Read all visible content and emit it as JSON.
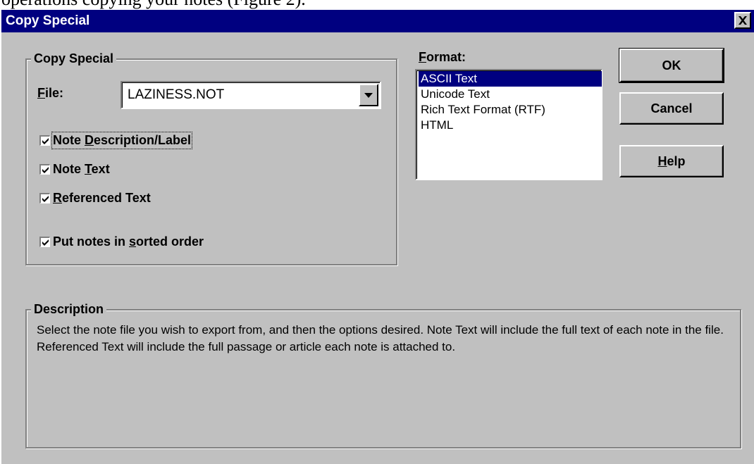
{
  "page_top_text": "operations copying your notes (Figure 2).",
  "dialog": {
    "title": "Copy Special",
    "close_glyph": "✕"
  },
  "copy_group": {
    "legend": "Copy Special",
    "file_label_u": "F",
    "file_label_rest": "ile:",
    "file_value": "LAZINESS.NOT",
    "options": [
      {
        "pre": "Note ",
        "u": "D",
        "post": "escription/Label",
        "checked": true
      },
      {
        "pre": "Note ",
        "u": "T",
        "post": "ext",
        "checked": true
      },
      {
        "pre": "",
        "u": "R",
        "post": "eferenced Text",
        "checked": true
      },
      {
        "pre": "Put notes in ",
        "u": "s",
        "post": "orted order",
        "checked": true
      }
    ]
  },
  "format": {
    "label_u": "F",
    "label_rest": "ormat:",
    "items": [
      "ASCII Text",
      "Unicode Text",
      "Rich Text Format (RTF)",
      "HTML"
    ],
    "selected": "ASCII Text"
  },
  "buttons": {
    "ok": "OK",
    "cancel": "Cancel",
    "help_u": "H",
    "help_rest": "elp"
  },
  "description": {
    "legend": "Description",
    "text": "Select the note file you wish to export from, and then the options desired. Note Text will include the full text of each note in the file. Referenced Text will include the full passage or article each note is attached to."
  },
  "colors": {
    "titlebar": "#000080",
    "face": "#c0c0c0",
    "selection": "#000080"
  }
}
